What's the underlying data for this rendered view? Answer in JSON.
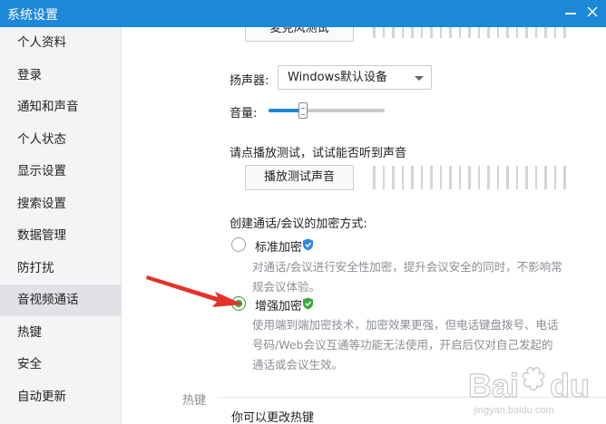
{
  "window": {
    "title": "系统设置"
  },
  "sidebar": {
    "items": [
      {
        "label": "个人资料"
      },
      {
        "label": "登录"
      },
      {
        "label": "通知和声音"
      },
      {
        "label": "个人状态"
      },
      {
        "label": "显示设置"
      },
      {
        "label": "搜索设置"
      },
      {
        "label": "数据管理"
      },
      {
        "label": "防打扰"
      },
      {
        "label": "音视频通话"
      },
      {
        "label": "热键"
      },
      {
        "label": "安全"
      },
      {
        "label": "自动更新"
      }
    ],
    "active_index": 8
  },
  "audio": {
    "mic_test_button": "麦克风测试",
    "speaker_label": "扬声器:",
    "speaker_selected": "Windows默认设备",
    "volume_label": "音量:",
    "volume_level": 0.3,
    "test_hint": "请点播放测试，试试能否听到声音",
    "play_test_button": "播放测试声音"
  },
  "encryption": {
    "heading": "创建通话/会议的加密方式:",
    "options": [
      {
        "label": "标准加密",
        "checked": false,
        "description_lines": [
          "对通话/会议进行安全性加密，提升会议安全的同时，不影响常",
          "规会议体验。"
        ],
        "shield_color": "#2f8ae5"
      },
      {
        "label": "增强加密",
        "checked": true,
        "description_lines": [
          "使用端到端加密技术，加密效果更强，但电话键盘拨号、电话",
          "号码/Web会议互通等功能无法使用，开启后仅对自己发起的",
          "通话或会议生效。"
        ],
        "shield_color": "#3aa83d"
      }
    ]
  },
  "hotkey": {
    "section_label": "热键",
    "hint": "你可以更改热键"
  },
  "colors": {
    "titlebar": "#1e88d8",
    "accent": "#1e88d8",
    "radio_checked": "#38a83a",
    "annotation_arrow": "#e5322d"
  },
  "watermark": {
    "text": "Baidu 经验",
    "url_text": "jingyan.baidu.com"
  }
}
